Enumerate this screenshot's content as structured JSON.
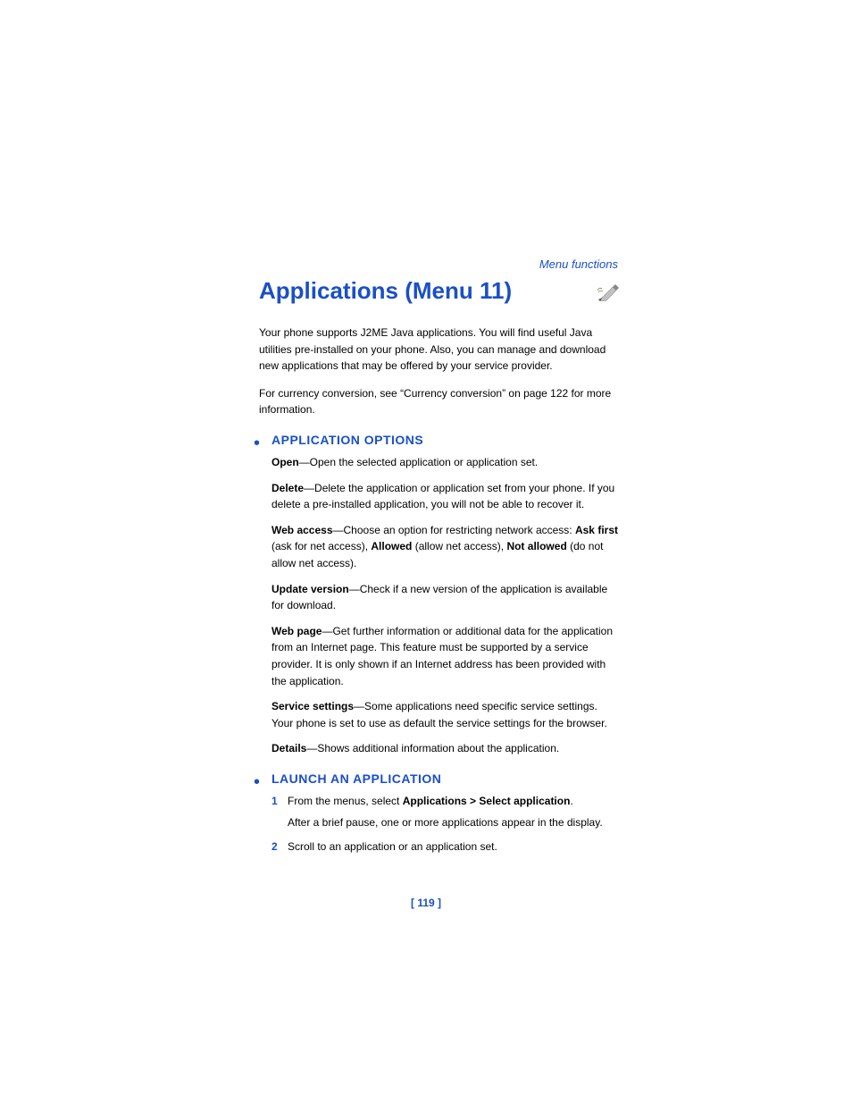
{
  "header": {
    "label": "Menu functions"
  },
  "title": "Applications (Menu 11)",
  "intro": {
    "p1": "Your phone supports J2ME Java applications. You will find useful Java utilities pre-installed on your phone. Also, you can manage and download new applications that may be offered by your service provider.",
    "p2": "For currency conversion, see “Currency conversion” on page 122 for more information."
  },
  "sections": {
    "app_options": {
      "title": "APPLICATION OPTIONS",
      "items": {
        "open": {
          "lead": "Open",
          "text": "—Open the selected application or application set."
        },
        "delete": {
          "lead": "Delete",
          "text": "—Delete the application or application set from your phone. If you delete a pre-installed application, you will not be able to recover it."
        },
        "web_access": {
          "lead": "Web access",
          "pre": "—Choose an option for restricting network access: ",
          "ask_first": "Ask first",
          "ask_first_after": " (ask for net access), ",
          "allowed": "Allowed",
          "allowed_after": " (allow net access), ",
          "not_allowed": "Not allowed",
          "not_allowed_after": " (do not allow net access)."
        },
        "update": {
          "lead": "Update version",
          "text": "—Check if a new version of the application is available for download."
        },
        "web_page": {
          "lead": "Web page",
          "text": "—Get further information or additional data for the application from an Internet page. This feature must be supported by a service provider. It is only shown if an Internet address has been provided with the application."
        },
        "service": {
          "lead": "Service settings",
          "text": "—Some applications need specific service settings. Your phone is set to use as default the service settings for the browser."
        },
        "details": {
          "lead": "Details",
          "text": "—Shows additional information about the application."
        }
      }
    },
    "launch": {
      "title": "LAUNCH AN APPLICATION",
      "steps": {
        "s1": {
          "num": "1",
          "pre": "From the menus, select ",
          "bold": "Applications > Select application",
          "post": ".",
          "sub": "After a brief pause, one or more applications appear in the display."
        },
        "s2": {
          "num": "2",
          "text": "Scroll to an application or an application set."
        }
      }
    }
  },
  "page_number": "[ 119 ]"
}
